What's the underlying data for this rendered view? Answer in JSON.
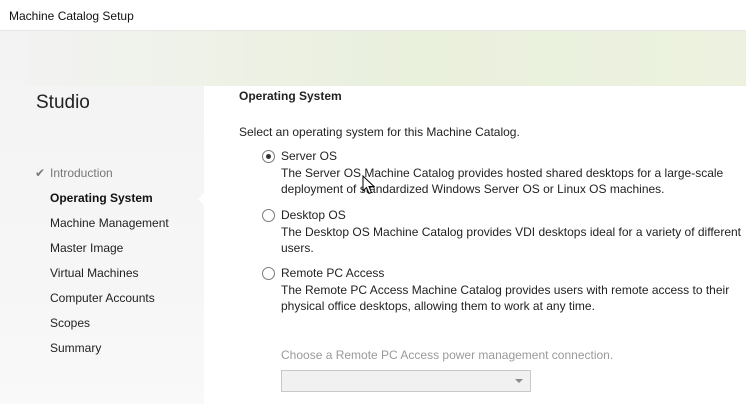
{
  "window": {
    "title": "Machine Catalog Setup"
  },
  "sidebar": {
    "brand": "Studio",
    "items": [
      {
        "label": "Introduction",
        "state": "done"
      },
      {
        "label": "Operating System",
        "state": "active"
      },
      {
        "label": "Machine Management",
        "state": "pending"
      },
      {
        "label": "Master Image",
        "state": "pending"
      },
      {
        "label": "Virtual Machines",
        "state": "pending"
      },
      {
        "label": "Computer Accounts",
        "state": "pending"
      },
      {
        "label": "Scopes",
        "state": "pending"
      },
      {
        "label": "Summary",
        "state": "pending"
      }
    ],
    "check_icon": "✔"
  },
  "main": {
    "section_title": "Operating System",
    "prompt": "Select an operating system for this Machine Catalog.",
    "options": [
      {
        "label": "Server OS",
        "selected": true,
        "description": "The Server OS Machine Catalog provides hosted shared desktops for a large-scale deployment of standardized Windows Server OS or Linux OS machines."
      },
      {
        "label": "Desktop OS",
        "selected": false,
        "description": "The Desktop OS Machine Catalog provides VDI desktops ideal for a variety of different users."
      },
      {
        "label": "Remote PC Access",
        "selected": false,
        "description": "The Remote PC Access Machine Catalog provides users with remote access to their physical office desktops, allowing them to work at any time."
      }
    ],
    "power_connection": {
      "label": "Choose a Remote PC Access power management connection.",
      "value": "",
      "enabled": false
    }
  },
  "colors": {
    "banner_accent": "#e9f0dc",
    "sidebar_bg": "#f4f4f4",
    "disabled_text": "#9a9a9a"
  }
}
